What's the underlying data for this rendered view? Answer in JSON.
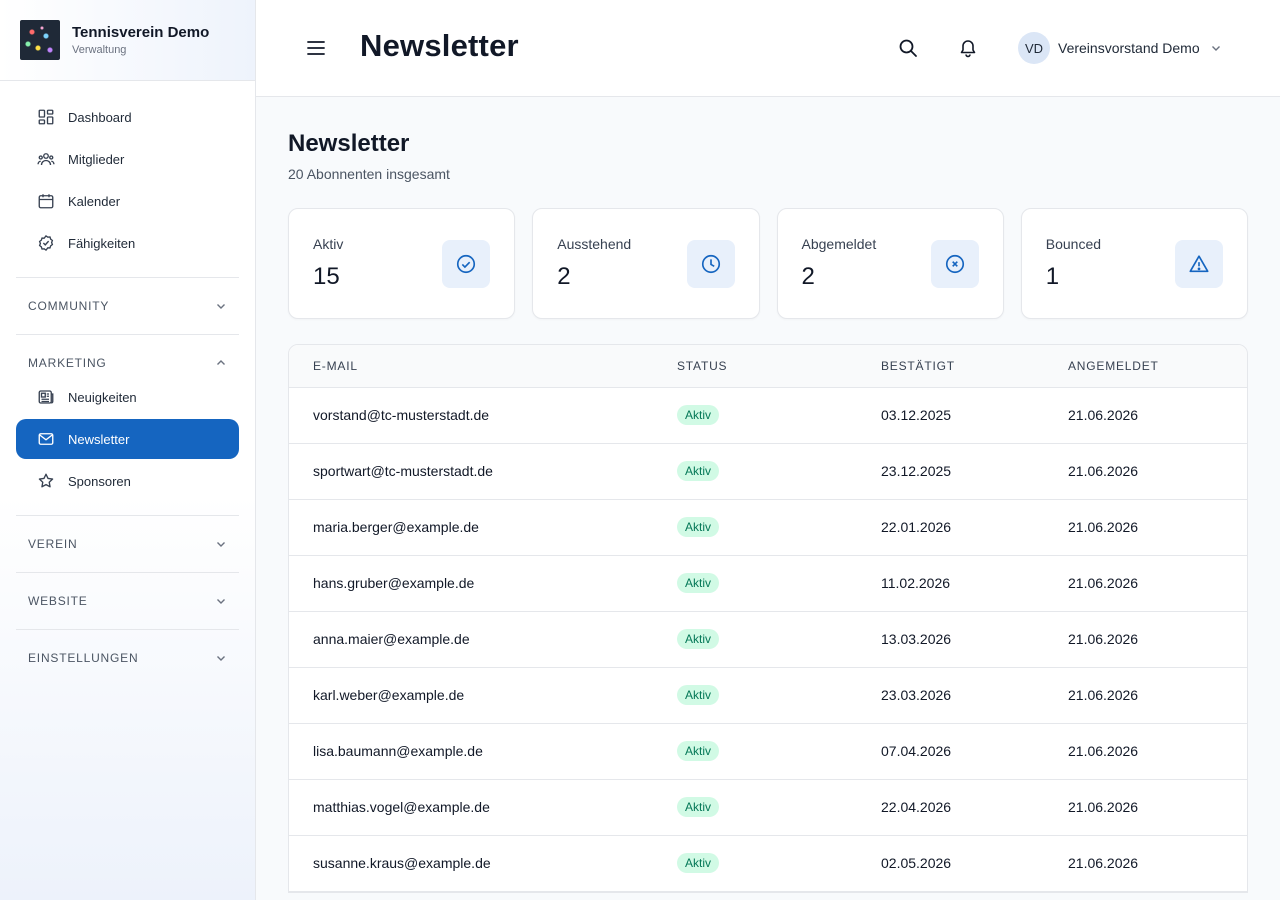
{
  "brand": {
    "title": "Tennisverein Demo",
    "subtitle": "Verwaltung"
  },
  "nav": {
    "items": [
      {
        "label": "Dashboard",
        "icon": "dashboard-icon"
      },
      {
        "label": "Mitglieder",
        "icon": "users-icon"
      },
      {
        "label": "Kalender",
        "icon": "calendar-icon"
      },
      {
        "label": "Fähigkeiten",
        "icon": "check-badge-icon"
      }
    ],
    "sections": {
      "community": "COMMUNITY",
      "marketing": "MARKETING",
      "verein": "VEREIN",
      "website": "WEBSITE",
      "einstellungen": "EINSTELLUNGEN"
    },
    "marketing_items": [
      {
        "label": "Neuigkeiten",
        "icon": "newspaper-icon"
      },
      {
        "label": "Newsletter",
        "icon": "mail-icon",
        "active": true
      },
      {
        "label": "Sponsoren",
        "icon": "star-icon"
      }
    ]
  },
  "header": {
    "title": "Newsletter",
    "user": {
      "initials": "VD",
      "name": "Vereinsvorstand Demo"
    }
  },
  "main": {
    "title": "Newsletter",
    "subtitle": "20 Abonnenten insgesamt",
    "stats": [
      {
        "label": "Aktiv",
        "value": "15",
        "icon": "check-circle-icon"
      },
      {
        "label": "Ausstehend",
        "value": "2",
        "icon": "clock-icon"
      },
      {
        "label": "Abgemeldet",
        "value": "2",
        "icon": "x-circle-icon"
      },
      {
        "label": "Bounced",
        "value": "1",
        "icon": "warning-icon"
      }
    ],
    "table": {
      "headers": [
        "E-MAIL",
        "STATUS",
        "BESTÄTIGT",
        "ANGEMELDET"
      ],
      "rows": [
        {
          "email": "vorstand@tc-musterstadt.de",
          "status": "Aktiv",
          "confirmed": "03.12.2025",
          "registered": "21.06.2026"
        },
        {
          "email": "sportwart@tc-musterstadt.de",
          "status": "Aktiv",
          "confirmed": "23.12.2025",
          "registered": "21.06.2026"
        },
        {
          "email": "maria.berger@example.de",
          "status": "Aktiv",
          "confirmed": "22.01.2026",
          "registered": "21.06.2026"
        },
        {
          "email": "hans.gruber@example.de",
          "status": "Aktiv",
          "confirmed": "11.02.2026",
          "registered": "21.06.2026"
        },
        {
          "email": "anna.maier@example.de",
          "status": "Aktiv",
          "confirmed": "13.03.2026",
          "registered": "21.06.2026"
        },
        {
          "email": "karl.weber@example.de",
          "status": "Aktiv",
          "confirmed": "23.03.2026",
          "registered": "21.06.2026"
        },
        {
          "email": "lisa.baumann@example.de",
          "status": "Aktiv",
          "confirmed": "07.04.2026",
          "registered": "21.06.2026"
        },
        {
          "email": "matthias.vogel@example.de",
          "status": "Aktiv",
          "confirmed": "22.04.2026",
          "registered": "21.06.2026"
        },
        {
          "email": "susanne.kraus@example.de",
          "status": "Aktiv",
          "confirmed": "02.05.2026",
          "registered": "21.06.2026"
        }
      ]
    }
  },
  "colors": {
    "accent": "#1565c0",
    "active_badge_bg": "#d1fae5",
    "active_badge_text": "#047857"
  }
}
